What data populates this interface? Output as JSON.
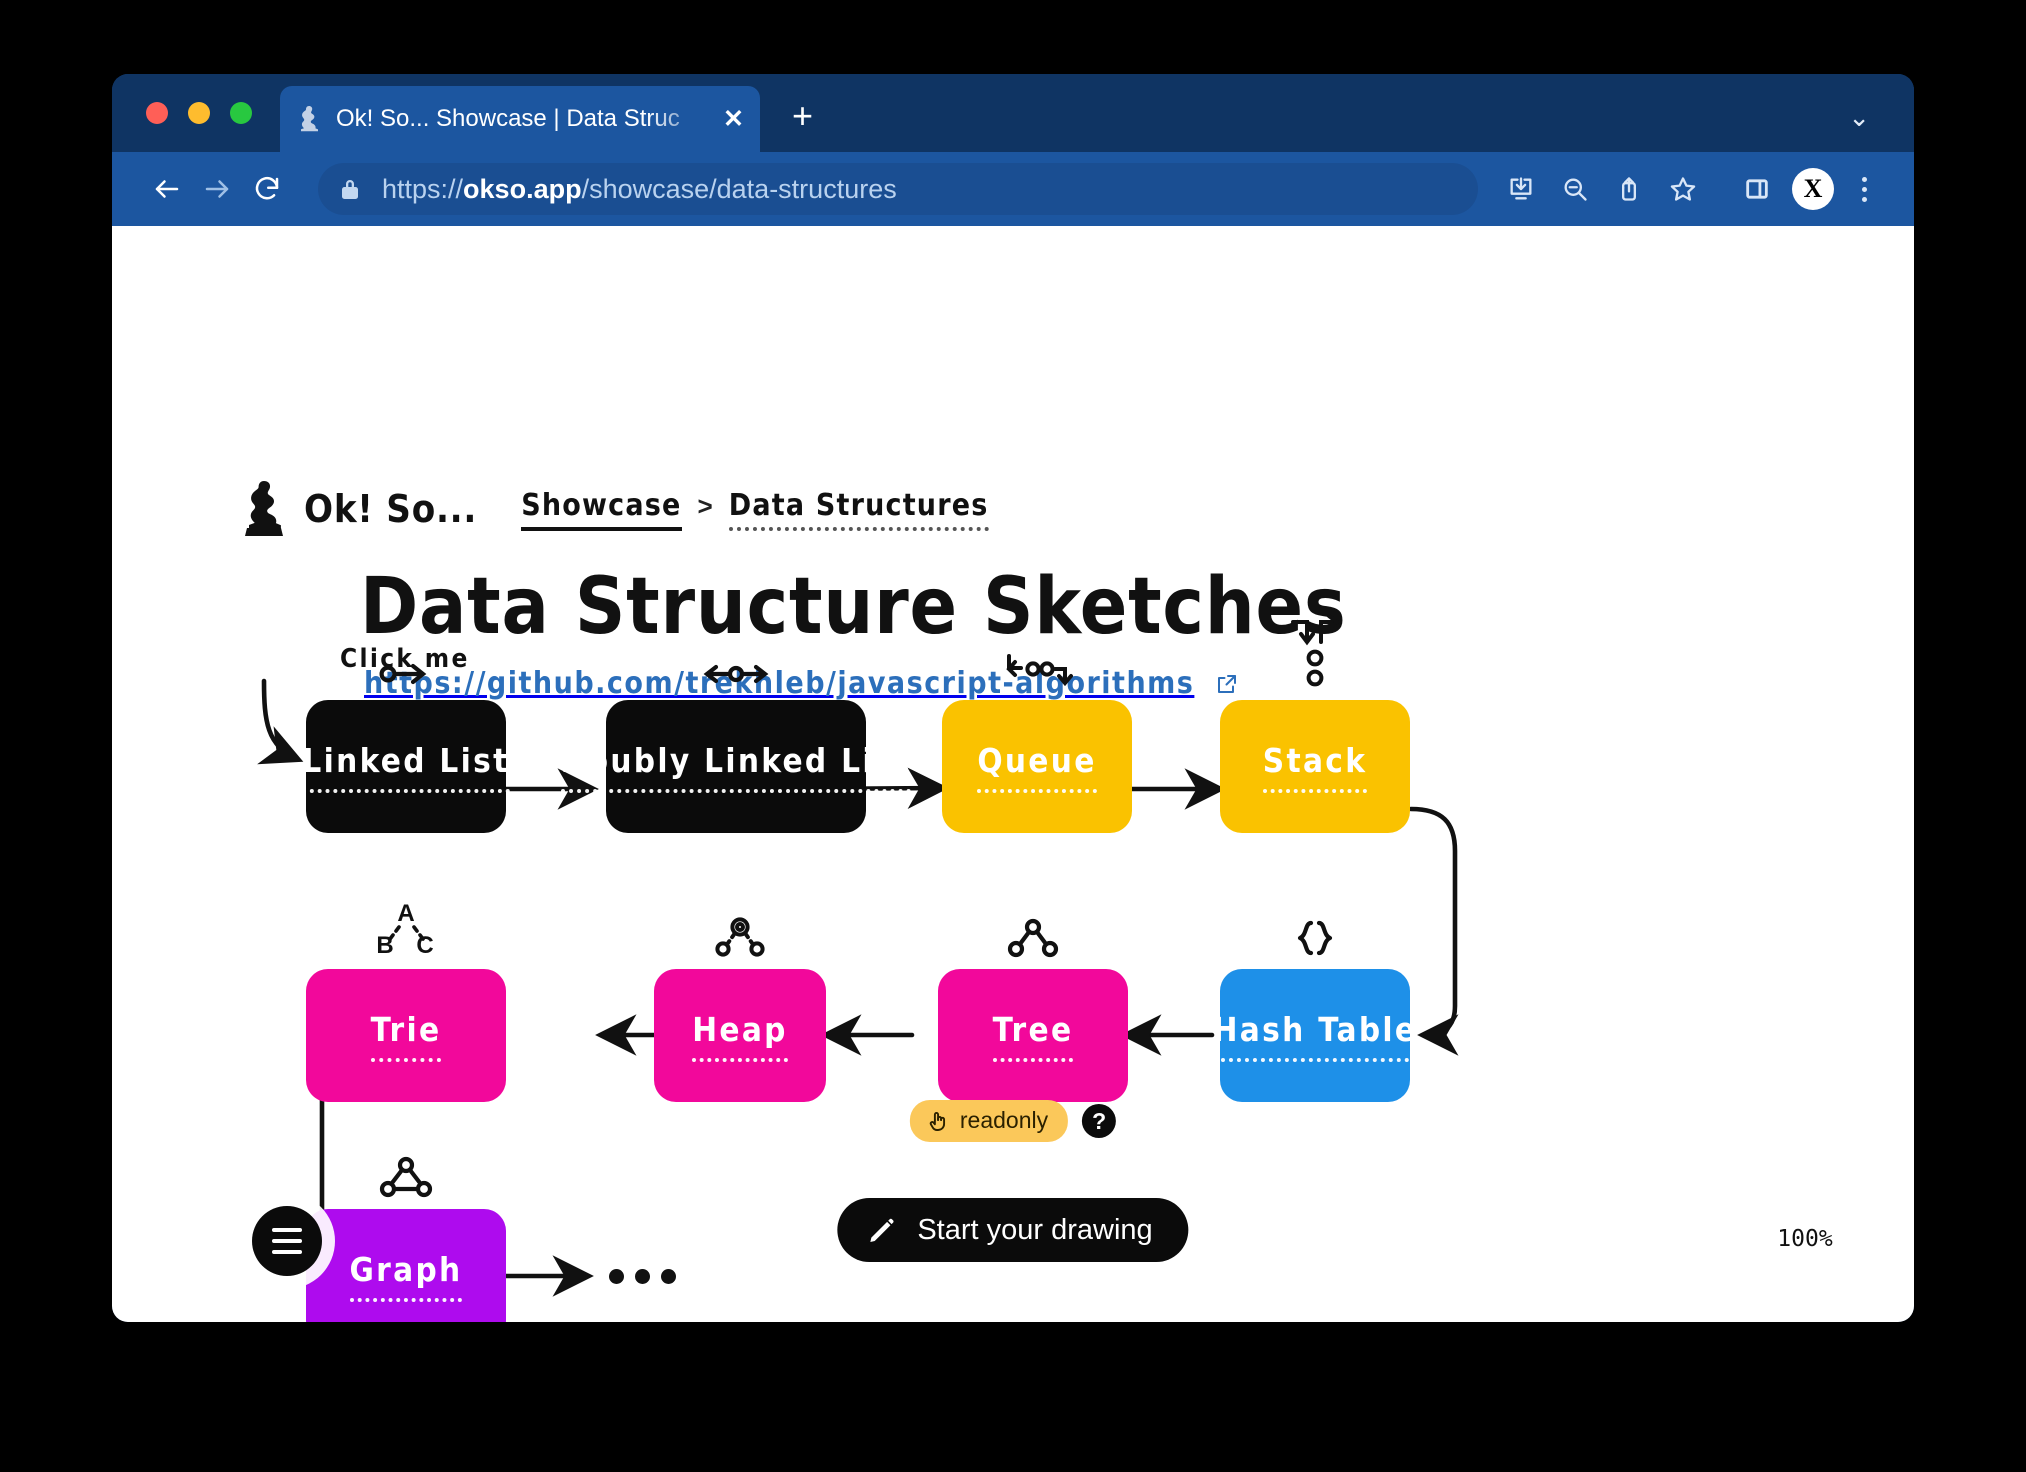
{
  "browser": {
    "tab": {
      "title": "Ok! So... Showcase | Data Struc",
      "close_label": "✕",
      "favicon_name": "thinker-favicon"
    },
    "new_tab_label": "+",
    "tabstrip_chevron": "⌄",
    "url": {
      "scheme": "https://",
      "host": "okso.app",
      "path": "/showcase/data-structures"
    },
    "toolbar_icons": [
      "install-app-icon",
      "zoom-out-icon",
      "share-icon",
      "bookmark-star-icon",
      "side-panel-icon"
    ],
    "profile_initial": "X",
    "menu_label": "⋮"
  },
  "site": {
    "brand": "Ok! So...",
    "breadcrumb": {
      "parent": "Showcase",
      "separator": ">",
      "current": "Data Structures"
    },
    "title": "Data Structure Sketches",
    "source_link": "https://github.com/trekhleb/javascript-algorithms"
  },
  "canvas": {
    "annotation": "Click me",
    "cards": [
      {
        "id": "linked-list",
        "label": "Linked List",
        "color": "#0b0b0b",
        "icon": "node-arrow-icon"
      },
      {
        "id": "doubly-linked-list",
        "label": "Doubly Linked List",
        "color": "#0b0b0b",
        "icon": "bidirectional-node-icon"
      },
      {
        "id": "queue",
        "label": "Queue",
        "color": "#FAC200",
        "icon": "queue-flow-icon"
      },
      {
        "id": "stack",
        "label": "Stack",
        "color": "#FAC200",
        "icon": "push-pop-icon"
      },
      {
        "id": "hash-table",
        "label": "Hash Table",
        "color": "#1E90E8",
        "icon": "curly-braces-icon"
      },
      {
        "id": "tree",
        "label": "Tree",
        "color": "#F2089B",
        "icon": "tree-nodes-icon"
      },
      {
        "id": "heap",
        "label": "Heap",
        "color": "#F2089B",
        "icon": "heap-nodes-icon"
      },
      {
        "id": "trie",
        "label": "Trie",
        "color": "#F2089B",
        "icon": "letter-tree-icon"
      },
      {
        "id": "graph",
        "label": "Graph",
        "color": "#AE0BEE",
        "icon": "graph-nodes-icon"
      }
    ],
    "more_indicator": "•••"
  },
  "controls": {
    "menu_name": "hamburger-menu",
    "zoom_level": "100%",
    "readonly_label": "readonly",
    "help_label": "?",
    "start_button": "Start your drawing"
  }
}
